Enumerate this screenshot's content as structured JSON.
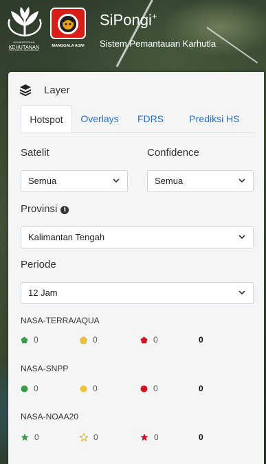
{
  "header": {
    "app_title": "SiPongi",
    "app_title_sup": "+",
    "app_subtitle": "Sistem Pemantauan Karhutla",
    "logo1_label": "KEHUTANAN",
    "logo1_top": "KEMENTERIAN",
    "logo1_sub": "REPUBLIK INDONESIA",
    "logo2_label": "MANGGALA AGNI"
  },
  "colors": {
    "accent": "#1f6fd6",
    "green": "#3d9a4a",
    "yellow": "#f2c230",
    "red": "#d8131f"
  },
  "panel": {
    "title": "Layer",
    "title_icon": "layers-icon",
    "tabs": [
      {
        "label": "Hotspot",
        "active": true
      },
      {
        "label": "Overlays",
        "active": false
      },
      {
        "label": "FDRS",
        "active": false
      },
      {
        "label": "Prediksi HS",
        "active": false
      }
    ],
    "satelit": {
      "label": "Satelit",
      "value": "Semua"
    },
    "confidence": {
      "label": "Confidence",
      "value": "Semua"
    },
    "provinsi": {
      "label": "Provinsi",
      "value": "Kalimantan Tengah",
      "info_icon": "info-icon"
    },
    "periode": {
      "label": "Periode",
      "value": "12 Jam"
    },
    "satellites": [
      {
        "name": "NASA-TERRA/AQUA",
        "shape": "pentagon",
        "low": "0",
        "mid": "0",
        "high": "0",
        "total": "0"
      },
      {
        "name": "NASA-SNPP",
        "shape": "circle",
        "low": "0",
        "mid": "0",
        "high": "0",
        "total": "0"
      },
      {
        "name": "NASA-NOAA20",
        "shape": "star",
        "low": "0",
        "mid": "0",
        "high": "0",
        "total": "0"
      }
    ]
  }
}
